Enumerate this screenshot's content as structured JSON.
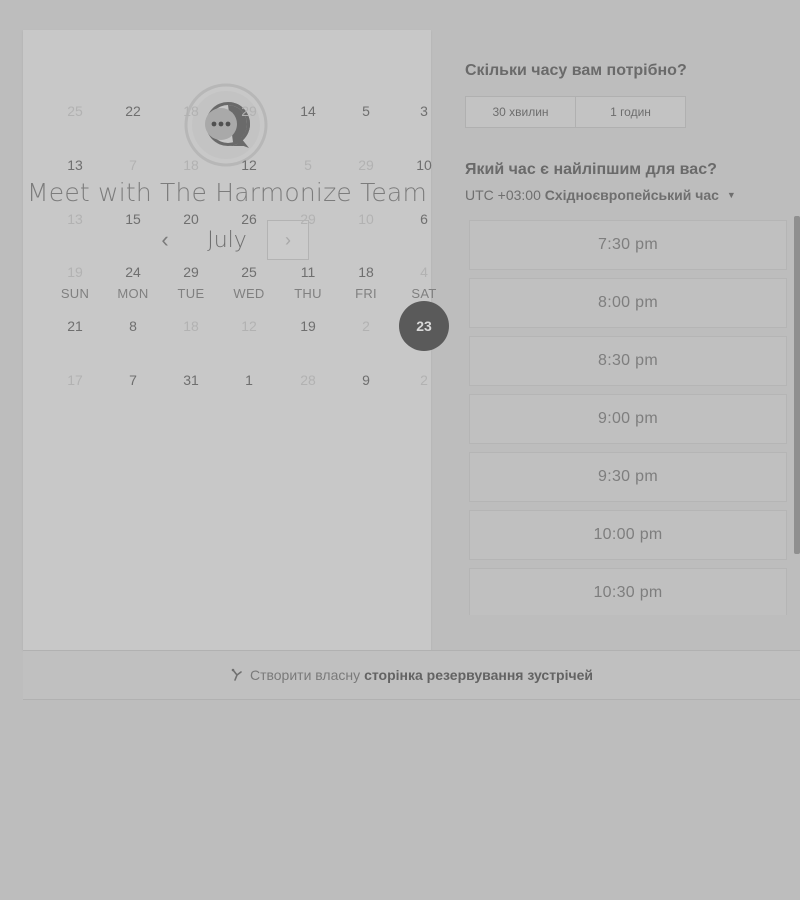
{
  "colors": {
    "background": "#bdbdbd",
    "panel": "#c8c8c8",
    "selected_day": "#5a5a5a",
    "text": "#6f6f6f",
    "dim_text": "#b2b2b2"
  },
  "calendar": {
    "logo_icon": "chat-bubble-icon",
    "title": "Meet with The Harmonize Team",
    "month": "July",
    "prev_icon": "chevron-left-icon",
    "next_icon": "chevron-right-icon",
    "weekdays": [
      "SUN",
      "MON",
      "TUE",
      "WED",
      "THU",
      "FRI",
      "SAT"
    ],
    "weeks": [
      [
        {
          "d": "25",
          "a": false
        },
        {
          "d": "22",
          "a": true
        },
        {
          "d": "18",
          "a": false
        },
        {
          "d": "29",
          "a": false
        },
        {
          "d": "14",
          "a": true
        },
        {
          "d": "5",
          "a": true
        },
        {
          "d": "3",
          "a": true
        }
      ],
      [
        {
          "d": "13",
          "a": true
        },
        {
          "d": "7",
          "a": false
        },
        {
          "d": "18",
          "a": false
        },
        {
          "d": "12",
          "a": true
        },
        {
          "d": "5",
          "a": false
        },
        {
          "d": "29",
          "a": false
        },
        {
          "d": "10",
          "a": true
        }
      ],
      [
        {
          "d": "13",
          "a": false
        },
        {
          "d": "15",
          "a": true
        },
        {
          "d": "20",
          "a": true
        },
        {
          "d": "26",
          "a": true
        },
        {
          "d": "29",
          "a": false
        },
        {
          "d": "10",
          "a": false
        },
        {
          "d": "6",
          "a": true
        }
      ],
      [
        {
          "d": "19",
          "a": false
        },
        {
          "d": "24",
          "a": true
        },
        {
          "d": "29",
          "a": true
        },
        {
          "d": "25",
          "a": true
        },
        {
          "d": "11",
          "a": true
        },
        {
          "d": "18",
          "a": true
        },
        {
          "d": "4",
          "a": false
        }
      ],
      [
        {
          "d": "21",
          "a": true
        },
        {
          "d": "8",
          "a": true
        },
        {
          "d": "18",
          "a": false
        },
        {
          "d": "12",
          "a": false
        },
        {
          "d": "19",
          "a": true
        },
        {
          "d": "2",
          "a": false
        },
        {
          "d": "23",
          "a": true,
          "selected": true
        }
      ],
      [
        {
          "d": "17",
          "a": false
        },
        {
          "d": "7",
          "a": true
        },
        {
          "d": "31",
          "a": true
        },
        {
          "d": "1",
          "a": true
        },
        {
          "d": "28",
          "a": false
        },
        {
          "d": "9",
          "a": true
        },
        {
          "d": "2",
          "a": false
        }
      ]
    ]
  },
  "booking": {
    "duration_question": "Скільки часу вам потрібно?",
    "durations": [
      "30 хвилин",
      "1 годин"
    ],
    "time_question": "Який час є найліпшим для вас?",
    "timezone_offset": "UTC +03:00",
    "timezone_name": "Східноєвропейський час",
    "timezone_caret": "caret-down-icon",
    "slots": [
      "7:30 pm",
      "8:00 pm",
      "8:30 pm",
      "9:00 pm",
      "9:30 pm",
      "10:00 pm",
      "10:30 pm"
    ]
  },
  "footer": {
    "icon": "brand-icon",
    "prefix": "Створити власну",
    "link": "сторінка резервування зустрічей"
  }
}
